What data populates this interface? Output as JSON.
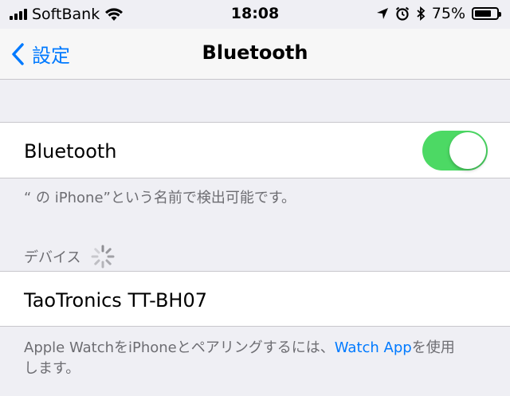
{
  "status_bar": {
    "carrier": "SoftBank",
    "time": "18:08",
    "battery_percent": "75%",
    "battery_level": 0.75,
    "icons": [
      "signal-icon",
      "wifi-icon",
      "location-icon",
      "alarm-icon",
      "bluetooth-icon",
      "battery-icon"
    ]
  },
  "nav": {
    "back_label": "設定",
    "title": "Bluetooth"
  },
  "bluetooth_row": {
    "label": "Bluetooth",
    "toggle_on": true,
    "toggle_color": "#4cd964"
  },
  "discoverable_note": "“           の iPhone”という名前で検出可能です。",
  "devices_header": "デバイス",
  "devices": [
    {
      "name": "TaoTronics TT-BH07"
    }
  ],
  "watch_note": {
    "part1": "Apple WatchをiPhoneとペアリングするには、",
    "link": "Watch App",
    "part2": "を使用",
    "line2": "します。"
  },
  "colors": {
    "accent": "#007aff",
    "background": "#efeff4",
    "secondary_text": "#6d6d72"
  }
}
